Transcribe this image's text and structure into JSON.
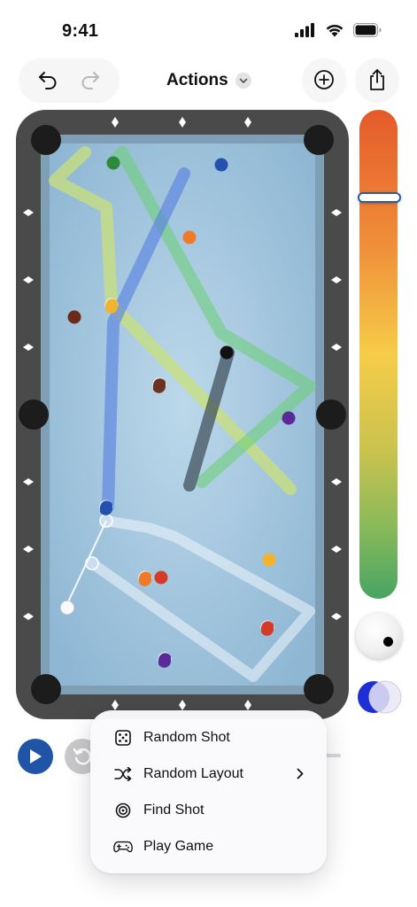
{
  "status_bar": {
    "time": "9:41"
  },
  "toolbar": {
    "title": "Actions"
  },
  "menu": {
    "items": [
      {
        "label": "Random Shot",
        "icon": "dice-icon",
        "has_submenu": false
      },
      {
        "label": "Random Layout",
        "icon": "shuffle-icon",
        "has_submenu": true
      },
      {
        "label": "Find Shot",
        "icon": "target-icon",
        "has_submenu": false
      },
      {
        "label": "Play Game",
        "icon": "gamepad-icon",
        "has_submenu": false
      }
    ]
  },
  "colors": {
    "accent": "#1f54a6",
    "felt": "#a9cbe2",
    "rail": "#4a4a4a",
    "power_top": "#e45a2a",
    "power_bottom": "#47a463"
  },
  "power_level": 0.18
}
